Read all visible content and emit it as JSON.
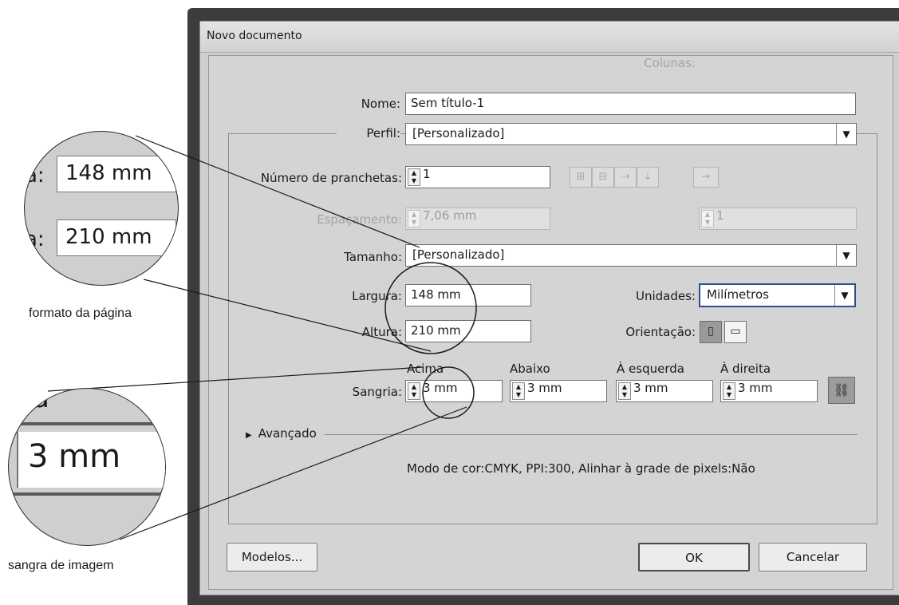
{
  "window": {
    "title": "Novo documento"
  },
  "form": {
    "name_label": "Nome:",
    "name_value": "Sem título-1",
    "profile_label": "Perfil:",
    "profile_value": "[Personalizado]",
    "artboards_label": "Número de pranchetas:",
    "artboards_value": "1",
    "spacing_label": "Espaçamento:",
    "spacing_value": "7,06 mm",
    "columns_label": "Colunas:",
    "columns_value": "1",
    "size_label": "Tamanho:",
    "size_value": "[Personalizado]",
    "width_label": "Largura:",
    "width_value": "148 mm",
    "units_label": "Unidades:",
    "units_value": "Milímetros",
    "height_label": "Altura:",
    "height_value": "210 mm",
    "orientation_label": "Orientação:",
    "bleed_label": "Sangria:",
    "bleed_headers": [
      "Acima",
      "Abaixo",
      "À esquerda",
      "À direita"
    ],
    "bleed_values": [
      "3 mm",
      "3 mm",
      "3 mm",
      "3 mm"
    ],
    "advanced_label": "Avançado",
    "summary": "Modo de cor:CMYK, PPI:300, Alinhar à grade de pixels:Não"
  },
  "buttons": {
    "templates": "Modelos...",
    "ok": "OK",
    "cancel": "Cancelar"
  },
  "callouts": {
    "zoom_top_label_1": "a:",
    "zoom_top_value_1": "148 mm",
    "zoom_top_label_2": "a:",
    "zoom_top_value_2": "210 mm",
    "zoom_top_caption": "formato da página",
    "zoom_bottom_fragment": "ra",
    "zoom_bottom_value": "3 mm",
    "zoom_bottom_caption": "sangra de imagem"
  },
  "icons": {
    "spinner": "up-down-arrows-icon",
    "dropdown": "chevron-down-icon",
    "advanced": "triangle-right-icon",
    "link": "chain-link-icon",
    "portrait": "portrait-orientation-icon",
    "landscape": "landscape-orientation-icon"
  }
}
